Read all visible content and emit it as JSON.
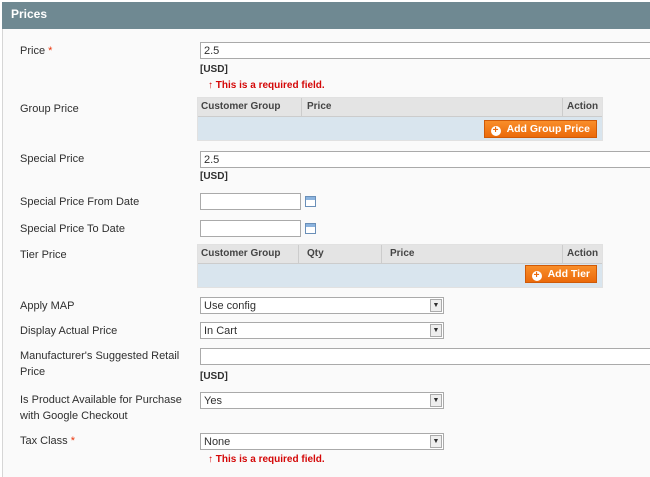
{
  "section_title": "Prices",
  "required_marker": "*",
  "usd": "[USD]",
  "error_text": "↑ This is a required field.",
  "price": {
    "label": "Price",
    "value": "2.5"
  },
  "group_price": {
    "label": "Group Price",
    "columns": [
      "Customer Group",
      "Price",
      "Action"
    ],
    "button": "Add Group Price"
  },
  "special_price": {
    "label": "Special Price",
    "value": "2.5"
  },
  "special_from": {
    "label": "Special Price From Date",
    "value": ""
  },
  "special_to": {
    "label": "Special Price To Date",
    "value": ""
  },
  "tier_price": {
    "label": "Tier Price",
    "columns": [
      "Customer Group",
      "Qty",
      "Price",
      "Action"
    ],
    "button": "Add Tier"
  },
  "apply_map": {
    "label": "Apply MAP",
    "value": "Use config"
  },
  "display_actual": {
    "label": "Display Actual Price",
    "value": "In Cart"
  },
  "msrp": {
    "label": "Manufacturer's Suggested Retail Price",
    "value": ""
  },
  "google": {
    "label": "Is Product Available for Purchase with Google Checkout",
    "value": "Yes"
  },
  "tax_class": {
    "label": "Tax Class",
    "value": "None"
  }
}
